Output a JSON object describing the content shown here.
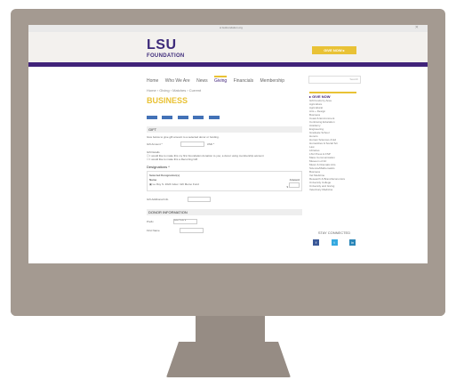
{
  "browser": {
    "url": "● lsufoundation.org"
  },
  "header": {
    "logo_top": "LSU",
    "logo_bottom": "FOUNDATION",
    "give_button": "GIVE NOW ▸"
  },
  "nav": {
    "items": [
      "Home",
      "Who We Are",
      "News",
      "Giving",
      "Financials",
      "Membership"
    ],
    "active": "Giving",
    "search_placeholder": "Search"
  },
  "breadcrumb": "Home › Giving › Matches › Current",
  "page_title": "BUSINESS",
  "share_buttons": [
    "Share",
    "Like",
    "Tweet",
    "Google+",
    "Email"
  ],
  "gift": {
    "section_title": "GIFT",
    "instructions": "Give below to give gift amount to a selected donor or funding.",
    "amount_label": "Gift Amount *",
    "amount_prefix": "$",
    "amount_suffix": "USD *",
    "checks": [
      "Gift Details",
      "☐ I would like to make this my first Foundation donation to you; a donor using membership account",
      "☐ I would like to make this a Recurring Gift"
    ],
    "designations_label": "Designations *",
    "designations_box_title": "Selected Designation(s)",
    "designations_head_name": "Name",
    "designations_head_amount": "Amount",
    "designation_row": "▣ Le Roy S. 2024 Index: Gift Memo Fund",
    "designation_row_prefix": "$",
    "additional_label": "Gift Additional Info"
  },
  "donor": {
    "section_title": "DONOR INFORMATION",
    "fields": [
      {
        "label": "Prefix",
        "value": "Select Prefix ▼"
      },
      {
        "label": "First Name",
        "value": ""
      }
    ]
  },
  "sidebar": {
    "title": "▸ GIVE NOW",
    "items": [
      "Gift Funds by Area",
      "Agriculture",
      "Agricultural",
      "Arts + Design",
      "Business",
      "Coast & Environment",
      "Continuing Education",
      "Academy",
      "Engineering",
      "Graduate School",
      "Honors",
      "Human Sciences & Ed",
      "Humanities & Social Sci",
      "Law",
      "Libraries",
      "LSU Press & FSP",
      "Mass Communication",
      "Museum of Art",
      "Music & Dramatic Arts",
      "Science/Mathematics",
      "Business",
      "Vet Medicine",
      "Research & Brand Economics",
      "University College",
      "University and Giving",
      "Veterinary Medicine"
    ],
    "stay_connected": "STAY CONNECTED",
    "social": [
      {
        "icon": "facebook-icon",
        "glyph": "f",
        "color": "#3b5998"
      },
      {
        "icon": "twitter-icon",
        "glyph": "t",
        "color": "#35a9e0"
      },
      {
        "icon": "linkedin-icon",
        "glyph": "in",
        "color": "#2b86b8"
      }
    ]
  }
}
